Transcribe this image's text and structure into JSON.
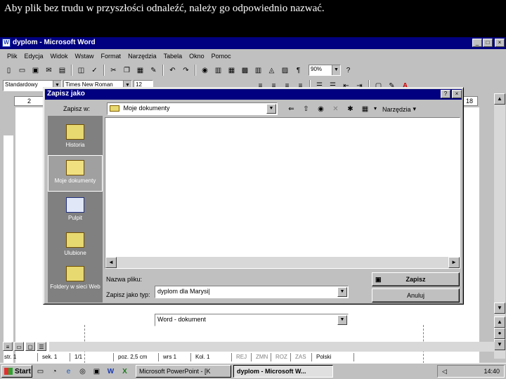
{
  "caption": "Aby plik bez trudu w przyszłości odnaleźć, należy go odpowiednio nazwać.",
  "window": {
    "title": "dyplom - Microsoft Word",
    "icon": "W",
    "controls": {
      "minimize": "_",
      "maximize": "□",
      "close": "×"
    }
  },
  "menu": [
    "Plik",
    "Edycja",
    "Widok",
    "Wstaw",
    "Format",
    "Narzędzia",
    "Tabela",
    "Okno",
    "Pomoc"
  ],
  "toolbar": {
    "zoom": "90%",
    "zoom_suffix": "?"
  },
  "format_bar": {
    "style": "Standardowy",
    "font": "Times New Roman",
    "size": "12"
  },
  "ruler_marks": [
    "2",
    "18"
  ],
  "dialog": {
    "title": "Zapisz jako",
    "help": "?",
    "close": "×",
    "save_in_label": "Zapisz w:",
    "save_in_value": "Moje dokumenty",
    "tools_label": "Narzędzia",
    "places": [
      "Historia",
      "Moje dokumenty",
      "Pulpit",
      "Ulubione",
      "Foldery w sieci Web"
    ],
    "filename_label": "Nazwa pliku:",
    "filename_value": "dyplom dla Marysi",
    "filetype_label": "Zapisz jako typ:",
    "filetype_value": "Word - dokument",
    "save_button": "Zapisz",
    "cancel_button": "Anuluj"
  },
  "status": {
    "page": "str. 1",
    "section": "sek. 1",
    "pages": "1/1",
    "position": "poz. 2,5 cm",
    "line": "wrs 1",
    "column": "Kol. 1",
    "rec": "REJ",
    "trk": "ZMN",
    "ext": "ROZ",
    "ovr": "ZAS",
    "language": "Polski"
  },
  "taskbar": {
    "start": "Start",
    "tasks": [
      "Microsoft PowerPoint - [K",
      "dyplom - Microsoft W..."
    ],
    "clock": "14:40"
  },
  "colors": {
    "titlebar": "#000080",
    "face": "#c0c0c0",
    "desktop": "#000000"
  }
}
